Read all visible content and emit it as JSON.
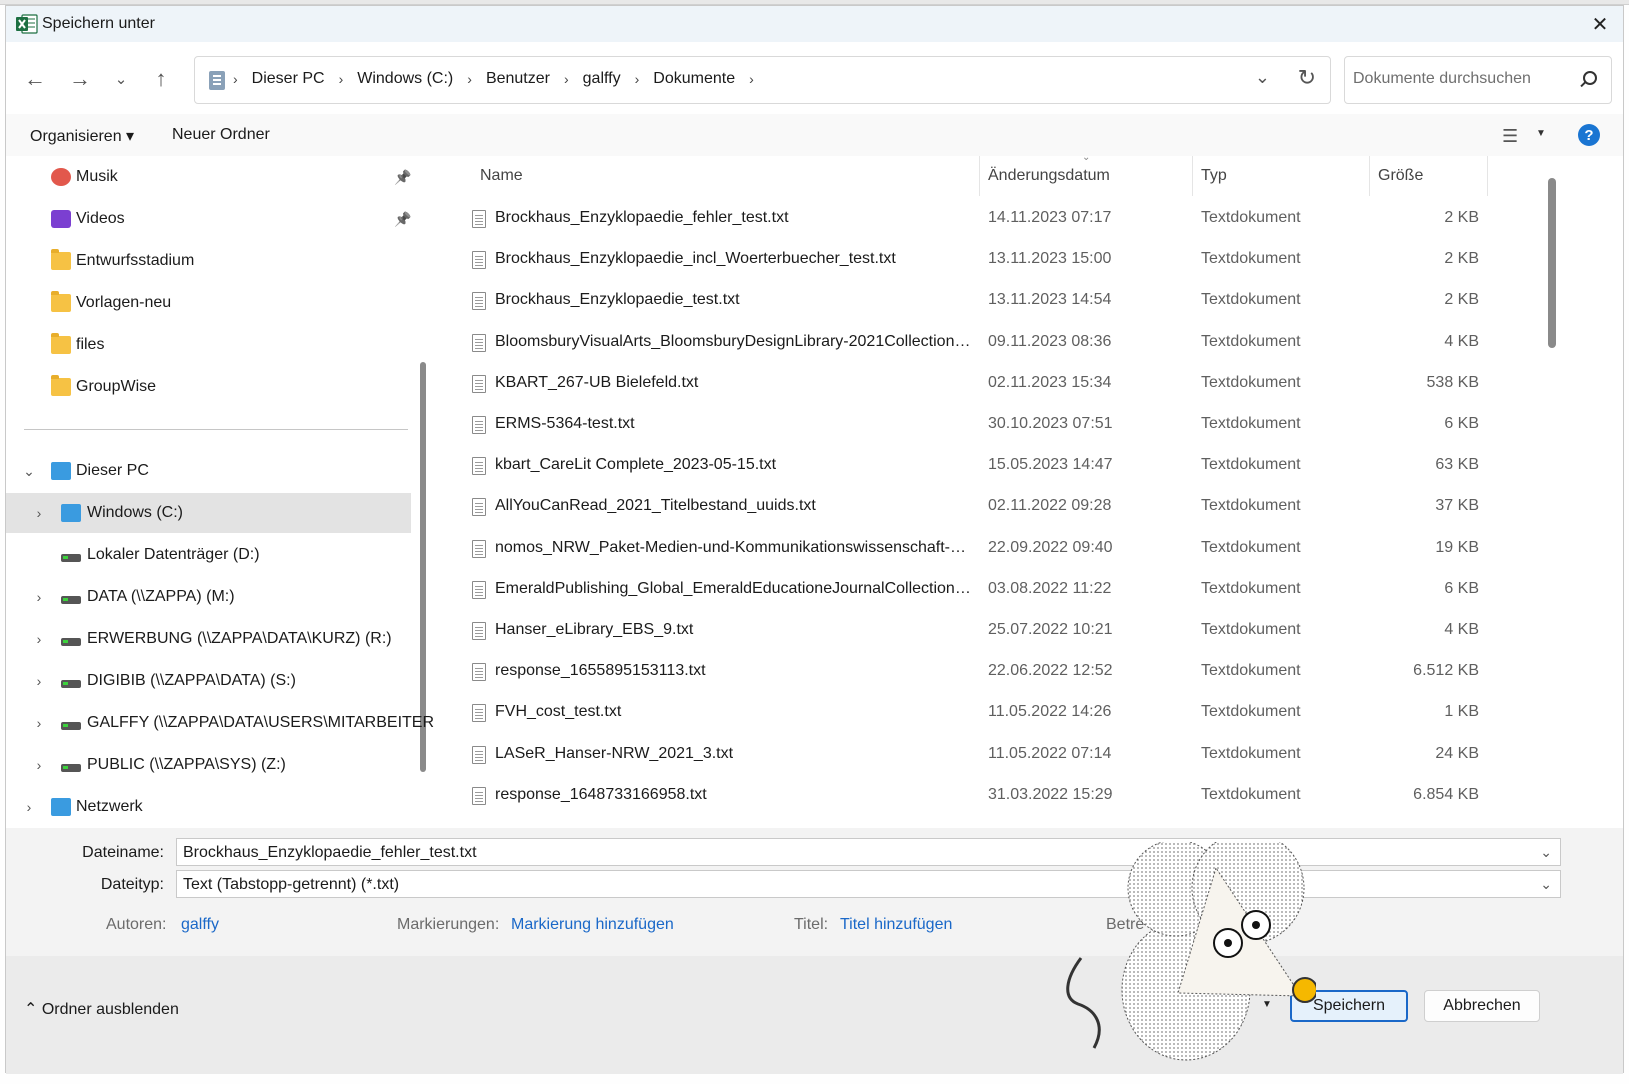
{
  "window": {
    "title": "Speichern unter",
    "partial_background_text": "Dokumente"
  },
  "addressbar": {
    "crumbs": [
      "Dieser PC",
      "Windows  (C:)",
      "Benutzer",
      "galffy",
      "Dokumente"
    ],
    "separator": "›",
    "search_placeholder": "Dokumente durchsuchen"
  },
  "commandbar": {
    "organize_label": "Organisieren ▾",
    "new_folder_label": "Neuer Ordner",
    "help_label": "?"
  },
  "navigation": {
    "quick_access": [
      {
        "label": "Musik",
        "icon": "music-icon",
        "pinned": true
      },
      {
        "label": "Videos",
        "icon": "videos-icon",
        "pinned": true
      },
      {
        "label": "Entwurfsstadium",
        "icon": "folder-icon"
      },
      {
        "label": "Vorlagen-neu",
        "icon": "folder-icon"
      },
      {
        "label": "files",
        "icon": "folder-icon"
      },
      {
        "label": "GroupWise",
        "icon": "folder-icon"
      }
    ],
    "this_pc": {
      "label": "Dieser PC",
      "expanded": true,
      "children": [
        {
          "label": "Windows  (C:)",
          "icon": "windows-drive-icon",
          "selected": true,
          "expandable": true
        },
        {
          "label": "Lokaler Datenträger (D:)",
          "icon": "local-drive-icon",
          "expandable": false
        },
        {
          "label": "DATA (\\\\ZAPPA) (M:)",
          "icon": "network-drive-icon",
          "expandable": true
        },
        {
          "label": "ERWERBUNG (\\\\ZAPPA\\DATA\\KURZ) (R:)",
          "icon": "network-drive-icon",
          "expandable": true
        },
        {
          "label": "DIGIBIB (\\\\ZAPPA\\DATA) (S:)",
          "icon": "network-drive-icon",
          "expandable": true
        },
        {
          "label": "GALFFY (\\\\ZAPPA\\DATA\\USERS\\MITARBEITER) (",
          "icon": "network-drive-icon",
          "expandable": true
        },
        {
          "label": "PUBLIC (\\\\ZAPPA\\SYS) (Z:)",
          "icon": "network-drive-icon",
          "expandable": true
        }
      ]
    },
    "network": {
      "label": "Netzwerk",
      "icon": "network-icon"
    }
  },
  "filelist": {
    "columns": [
      "Name",
      "Änderungsdatum",
      "Typ",
      "Größe"
    ],
    "rows": [
      {
        "name": "Brockhaus_Enzyklopaedie_fehler_test.txt",
        "date": "14.11.2023 07:17",
        "type": "Textdokument",
        "size": "2 KB"
      },
      {
        "name": "Brockhaus_Enzyklopaedie_incl_Woerterbuecher_test.txt",
        "date": "13.11.2023 15:00",
        "type": "Textdokument",
        "size": "2 KB"
      },
      {
        "name": "Brockhaus_Enzyklopaedie_test.txt",
        "date": "13.11.2023 14:54",
        "type": "Textdokument",
        "size": "2 KB"
      },
      {
        "name": "BloomsburyVisualArts_BloomsburyDesignLibrary-2021Collection_K...",
        "date": "09.11.2023 08:36",
        "type": "Textdokument",
        "size": "4 KB"
      },
      {
        "name": "KBART_267-UB Bielefeld.txt",
        "date": "02.11.2023 15:34",
        "type": "Textdokument",
        "size": "538 KB"
      },
      {
        "name": "ERMS-5364-test.txt",
        "date": "30.10.2023 07:51",
        "type": "Textdokument",
        "size": "6 KB"
      },
      {
        "name": "kbart_CareLit Complete_2023-05-15.txt",
        "date": "15.05.2023 14:47",
        "type": "Textdokument",
        "size": "63 KB"
      },
      {
        "name": "AllYouCanRead_2021_Titelbestand_uuids.txt",
        "date": "02.11.2022 09:28",
        "type": "Textdokument",
        "size": "37 KB"
      },
      {
        "name": "nomos_NRW_Paket-Medien-und-Kommunikationswissenschaft-20...",
        "date": "22.09.2022 09:40",
        "type": "Textdokument",
        "size": "19 KB"
      },
      {
        "name": "EmeraldPublishing_Global_EmeraldEducationeJournalCollection_20...",
        "date": "03.08.2022 11:22",
        "type": "Textdokument",
        "size": "6 KB"
      },
      {
        "name": "Hanser_eLibrary_EBS_9.txt",
        "date": "25.07.2022 10:21",
        "type": "Textdokument",
        "size": "4 KB"
      },
      {
        "name": "response_1655895153113.txt",
        "date": "22.06.2022 12:52",
        "type": "Textdokument",
        "size": "6.512 KB"
      },
      {
        "name": "FVH_cost_test.txt",
        "date": "11.05.2022 14:26",
        "type": "Textdokument",
        "size": "1 KB"
      },
      {
        "name": "LASeR_Hanser-NRW_2021_3.txt",
        "date": "11.05.2022 07:14",
        "type": "Textdokument",
        "size": "24 KB"
      },
      {
        "name": "response_1648733166958.txt",
        "date": "31.03.2022 15:29",
        "type": "Textdokument",
        "size": "6.854 KB"
      }
    ]
  },
  "form": {
    "filename_label": "Dateiname:",
    "filename_value": "Brockhaus_Enzyklopaedie_fehler_test.txt",
    "filetype_label": "Dateityp:",
    "filetype_value": "Text (Tabstopp-getrennt) (*.txt)",
    "authors_label": "Autoren:",
    "authors_value": "galffy",
    "tags_label": "Markierungen:",
    "tags_value": "Markierung hinzufügen",
    "title_label": "Titel:",
    "title_value": "Titel hinzufügen",
    "subject_label_partial": "Betre"
  },
  "footer": {
    "toggle_label": "Ordner ausblenden",
    "save_label": "Speichern",
    "cancel_label": "Abbrechen"
  },
  "colors": {
    "accent": "#1a68c8",
    "selected_row": "#e3e3e3",
    "title_bg": "#eef4f9"
  }
}
